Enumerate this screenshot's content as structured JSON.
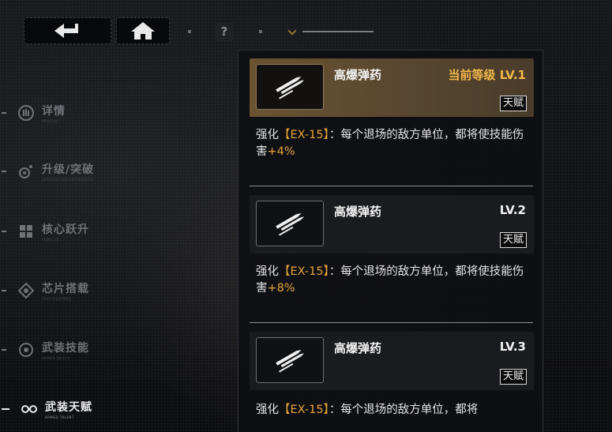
{
  "top": {
    "back_icon": "back-arrow-icon",
    "home_icon": "home-icon",
    "help_label": "?"
  },
  "sidebar": {
    "items": [
      {
        "label": "详情",
        "sub": "PROFILE",
        "icon": "info-icon",
        "active": false
      },
      {
        "label": "升级/突破",
        "sub": "UPGRADE/BREAKTHROUGH",
        "icon": "upgrade-icon",
        "active": false
      },
      {
        "label": "核心跃升",
        "sub": "CORE UP",
        "icon": "core-icon",
        "active": false
      },
      {
        "label": "芯片搭载",
        "sub": "CHIP EQUIPPED",
        "icon": "chip-icon",
        "active": false
      },
      {
        "label": "武装技能",
        "sub": "ARMED SKILLS",
        "icon": "skill-icon",
        "active": false
      },
      {
        "label": "武装天赋",
        "sub": "ARMED TALENT",
        "icon": "talent-icon",
        "active": true
      }
    ]
  },
  "talents": [
    {
      "name": "高爆弹药",
      "level": "当前等级 LV.1",
      "tag": "天赋",
      "current": true,
      "desc_prefix": "强化",
      "desc_highlight": "【EX-15】",
      "desc_middle": "：每个退场的敌方单位，都将使技能伤害",
      "desc_bonus": "+4%"
    },
    {
      "name": "高爆弹药",
      "level": "LV.2",
      "tag": "天赋",
      "current": false,
      "desc_prefix": "强化",
      "desc_highlight": "【EX-15】",
      "desc_middle": "：每个退场的敌方单位，都将使技能伤害",
      "desc_bonus": "+8%"
    },
    {
      "name": "高爆弹药",
      "level": "LV.3",
      "tag": "天赋",
      "current": false,
      "desc_prefix": "强化",
      "desc_highlight": "【EX-15】",
      "desc_middle": "：每个退场的敌方单位，都将",
      "desc_bonus": ""
    }
  ],
  "colors": {
    "accent": "#e5a33b",
    "current_level": "#f2b84a",
    "current_card": "#6a5331"
  }
}
